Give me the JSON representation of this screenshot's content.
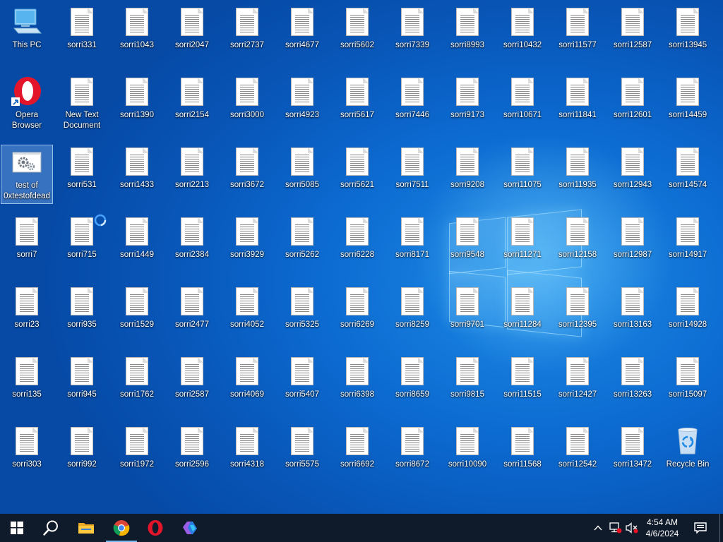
{
  "desktop": {
    "special_icons": [
      {
        "id": "this-pc",
        "label": "This PC",
        "icon": "this-pc-icon"
      },
      {
        "id": "opera",
        "label": "Opera Browser",
        "icon": "opera-icon"
      },
      {
        "id": "test",
        "label": "test of 0xtestofdead",
        "icon": "settings-gear-icon"
      },
      {
        "id": "new-text",
        "label": "New Text Document",
        "icon": "text-file-icon"
      },
      {
        "id": "recycle",
        "label": "Recycle Bin",
        "icon": "recycle-bin-icon"
      }
    ],
    "grid": [
      [
        "This PC",
        "sorri331",
        "sorri1043",
        "sorri2047",
        "sorri2737",
        "sorri4677",
        "sorri5602",
        "sorri7339",
        "sorri8993",
        "sorri10432",
        "sorri11577",
        "sorri12587",
        "sorri13945"
      ],
      [
        "Opera Browser",
        "New Text Document",
        "sorri1390",
        "sorri2154",
        "sorri3000",
        "sorri4923",
        "sorri5617",
        "sorri7446",
        "sorri9173",
        "sorri10671",
        "sorri11841",
        "sorri12601",
        "sorri14459"
      ],
      [
        "test of 0xtestofdead",
        "sorri531",
        "sorri1433",
        "sorri2213",
        "sorri3672",
        "sorri5085",
        "sorri5621",
        "sorri7511",
        "sorri9208",
        "sorri11075",
        "sorri11935",
        "sorri12943",
        "sorri14574"
      ],
      [
        "sorri7",
        "sorri715",
        "sorri1449",
        "sorri2384",
        "sorri3929",
        "sorri5262",
        "sorri6228",
        "sorri8171",
        "sorri9548",
        "sorri11271",
        "sorri12158",
        "sorri12987",
        "sorri14917"
      ],
      [
        "sorri23",
        "sorri935",
        "sorri1529",
        "sorri2477",
        "sorri4052",
        "sorri5325",
        "sorri6269",
        "sorri8259",
        "sorri9701",
        "sorri11284",
        "sorri12395",
        "sorri13163",
        "sorri14928"
      ],
      [
        "sorri135",
        "sorri945",
        "sorri1762",
        "sorri2587",
        "sorri4069",
        "sorri5407",
        "sorri6398",
        "sorri8659",
        "sorri9815",
        "sorri11515",
        "sorri12427",
        "sorri13263",
        "sorri15097"
      ],
      [
        "sorri303",
        "sorri992",
        "sorri1972",
        "sorri2596",
        "sorri4318",
        "sorri5575",
        "sorri6692",
        "sorri8672",
        "sorri10090",
        "sorri11568",
        "sorri12542",
        "sorri13472",
        "Recycle Bin"
      ]
    ],
    "selected_label": "test of 0xtestofdead"
  },
  "taskbar": {
    "pinned": [
      {
        "name": "start-button",
        "icon": "windows-logo-icon"
      },
      {
        "name": "search-button",
        "icon": "search-icon"
      },
      {
        "name": "file-explorer-button",
        "icon": "folder-icon"
      },
      {
        "name": "chrome-button",
        "icon": "chrome-icon"
      },
      {
        "name": "opera-taskbar-button",
        "icon": "opera-icon"
      },
      {
        "name": "copilot-button",
        "icon": "copilot-icon"
      }
    ],
    "tray": {
      "chevron": "^",
      "network_icon": "network-disconnected-icon",
      "volume_icon": "volume-muted-icon",
      "notification_icon": "notification-icon"
    },
    "clock": {
      "time": "4:54 AM",
      "date": "4/6/2024"
    }
  },
  "colors": {
    "taskbar": "#0f1a2a",
    "desktop_accent": "#0c6ad0",
    "opera_red": "#e3152b",
    "chrome_red": "#db4437",
    "chrome_green": "#0f9d58",
    "chrome_yellow": "#f4b400",
    "chrome_blue": "#4285f4"
  }
}
